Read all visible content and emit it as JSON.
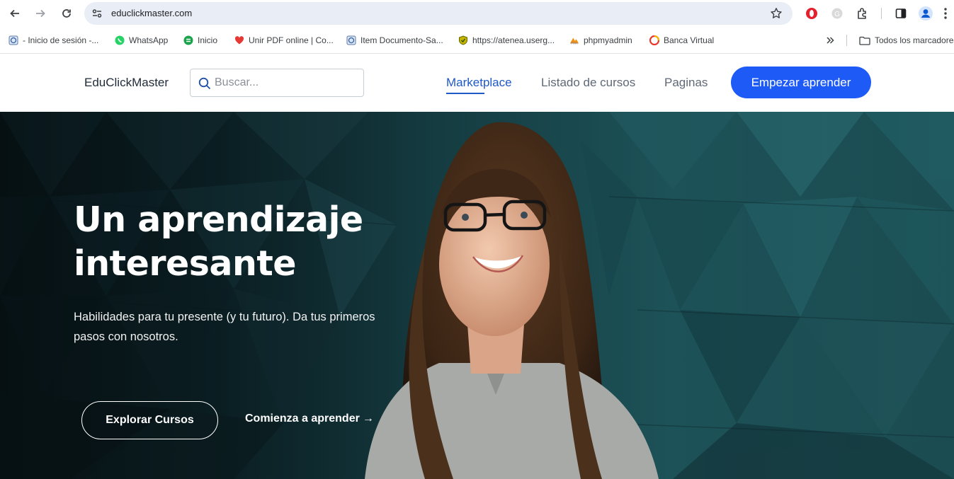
{
  "browser": {
    "url": "educlickmaster.com",
    "bookmarks": [
      {
        "label": "- Inicio de sesión -...",
        "icon": "globe-doc-icon"
      },
      {
        "label": "WhatsApp",
        "icon": "whatsapp-icon"
      },
      {
        "label": "Inicio",
        "icon": "green-s-icon"
      },
      {
        "label": "Unir PDF online | Co...",
        "icon": "heart-icon"
      },
      {
        "label": "Item Documento-Sa...",
        "icon": "globe-doc-icon"
      },
      {
        "label": "https://atenea.userg...",
        "icon": "shield-icon"
      },
      {
        "label": "phpmyadmin",
        "icon": "pma-icon"
      },
      {
        "label": "Banca Virtual",
        "icon": "bank-icon"
      }
    ],
    "all_bookmarks_label": "Todos los marcadores"
  },
  "site": {
    "brand": "EduClickMaster",
    "search_placeholder": "Buscar...",
    "nav": [
      {
        "label": "Marketplace",
        "active": true
      },
      {
        "label": "Listado de cursos",
        "active": false
      },
      {
        "label": "Paginas",
        "active": false
      }
    ],
    "cta_label": "Empezar aprender"
  },
  "hero": {
    "title_line1": "Un aprendizaje",
    "title_line2": "interesante",
    "subtitle": "Habilidades para tu presente (y tu futuro). Da tus primeros pasos con nosotros.",
    "primary_button": "Explorar Cursos",
    "secondary_link": "Comienza a aprender",
    "secondary_arrow": "→"
  },
  "colors": {
    "accent": "#1e5bf6",
    "nav_active": "#1f58c7",
    "hero_dark": "#0f2a30",
    "hero_teal": "#1f5a60"
  }
}
